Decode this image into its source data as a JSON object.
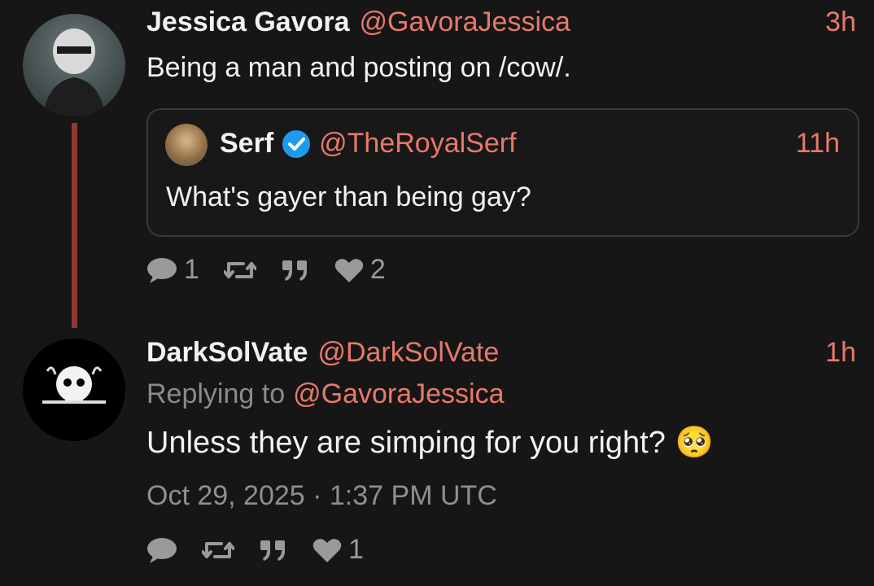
{
  "tweet1": {
    "author_name": "Jessica Gavora",
    "author_handle": "@GavoraJessica",
    "time": "3h",
    "text": "Being a man and posting on /cow/.",
    "quote": {
      "author_name": "Serf",
      "author_handle": "@TheRoyalSerf",
      "time": "11h",
      "text": "What's gayer than being gay?"
    },
    "stats": {
      "replies": "1",
      "likes": "2"
    }
  },
  "tweet2": {
    "author_name": "DarkSolVate",
    "author_handle": "@DarkSolVate",
    "time": "1h",
    "replying_prefix": "Replying to",
    "replying_handle": "@GavoraJessica",
    "text": "Unless they are simping for you right?",
    "emoji": "🥺",
    "timestamp": "Oct 29, 2025 · 1:37 PM UTC",
    "stats": {
      "likes": "1"
    }
  },
  "colors": {
    "accent": "#e8796b",
    "thread_line": "#8e3a34",
    "background": "#161616"
  },
  "icons": [
    "comment-icon",
    "retweet-icon",
    "quote-icon",
    "heart-icon",
    "verified-icon"
  ]
}
